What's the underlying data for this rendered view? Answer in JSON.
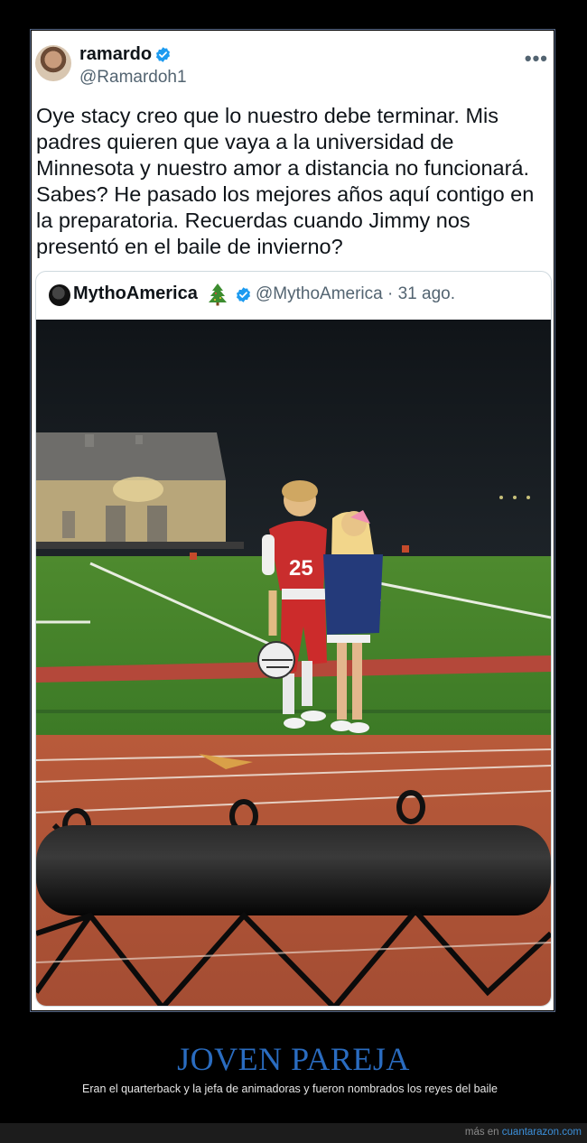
{
  "tweet": {
    "author_name": "ramardo",
    "author_handle": "@Ramardoh1",
    "more_label": "•••",
    "text": "Oye stacy creo que lo nuestro debe terminar. Mis padres quieren que vaya a la universidad de Minnesota y nuestro amor a distancia no funcionará. Sabes? He pasado los mejores años aquí contigo en la preparatoria. Recuerdas cuando Jimmy nos presentó en el baile de invierno?"
  },
  "quoted_tweet": {
    "author_name": "MythoAmerica",
    "author_handle": "@MythoAmerica",
    "date": "· 31 ago.",
    "jersey_number": "25"
  },
  "caption": {
    "title": "JOVEN PAREJA",
    "subtitle": "Eran el quarterback y la jefa de animadoras y fueron nombrados los reyes del baile"
  },
  "footer": {
    "prefix": "más en",
    "site": "cuantarazon.com"
  },
  "colors": {
    "verified_blue": "#1d9bf0",
    "caption_blue": "#2a6cc0",
    "site_link": "#3b8fd9"
  }
}
